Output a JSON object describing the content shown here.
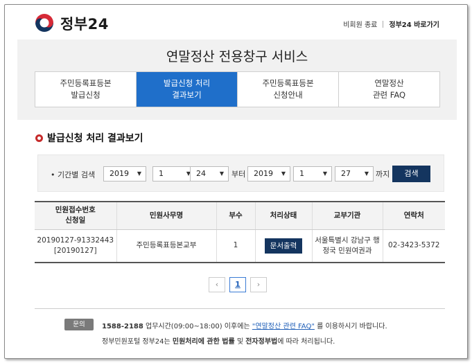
{
  "header": {
    "brand": "정부24",
    "logout_label": "비회원 종료",
    "shortcut_label": "정부24 바로가기"
  },
  "banner": {
    "title": "연말정산 전용창구 서비스",
    "tabs": [
      {
        "line1": "주민등록표등본",
        "line2": "발급신청",
        "active": false
      },
      {
        "line1": "발급신청 처리",
        "line2": "결과보기",
        "active": true
      },
      {
        "line1": "주민등록표등본",
        "line2": "신청안내",
        "active": false
      },
      {
        "line1": "연말정산",
        "line2": "관련 FAQ",
        "active": false
      }
    ]
  },
  "section": {
    "title": "발급신청 처리 결과보기"
  },
  "search": {
    "label": "• 기간별 검색",
    "from": {
      "year": "2019",
      "month": "1",
      "day": "24"
    },
    "from_word": "부터",
    "to": {
      "year": "2019",
      "month": "1",
      "day": "27"
    },
    "to_word": "까지",
    "button_label": "검색"
  },
  "table": {
    "headers": {
      "receipt_line1": "민원접수번호",
      "receipt_line2": "신청일",
      "service": "민원사무명",
      "copies": "부수",
      "status": "처리상태",
      "agency": "교부기관",
      "contact": "연락처"
    },
    "rows": [
      {
        "receipt_no": "20190127-91332443",
        "date": "[20190127]",
        "service": "주민등록표등본교부",
        "copies": "1",
        "status_button": "문서출력",
        "agency_line1": "서울특별시 강남구 행",
        "agency_line2": "정국 민원여권과",
        "contact": "02-3423-5372"
      }
    ]
  },
  "pager": {
    "prev": "‹",
    "current": "1",
    "next": "›"
  },
  "inquiry": {
    "badge": "문의",
    "phone": "1588-2188",
    "hours": " 업무시간(09:00~18:00) 이후에는 ",
    "faq_link": "\"연말정산 관련 FAQ\"",
    "tail": " 를 이용하시기 바랍니다.",
    "line2_a": "정부민원포털 정부24는 ",
    "line2_b": "민원처리에 관한 법률",
    "line2_c": " 및 ",
    "line2_d": "전자정부법",
    "line2_e": "에 따라 처리됩니다."
  },
  "colors": {
    "accent": "#1f6fca",
    "navy": "#14355f",
    "red": "#c62b2b"
  }
}
